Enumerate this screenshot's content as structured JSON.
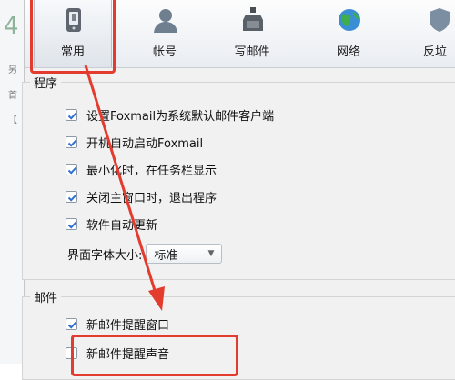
{
  "background": {
    "digit": "4",
    "side_chars": [
      "另",
      "首",
      "【"
    ]
  },
  "toolbar": {
    "tabs": [
      {
        "label": "常用",
        "icon": "phone-icon",
        "active": true
      },
      {
        "label": "帐号",
        "icon": "user-icon"
      },
      {
        "label": "写邮件",
        "icon": "ink-bottle-icon"
      },
      {
        "label": "网络",
        "icon": "globe-icon"
      },
      {
        "label": "反垃",
        "icon": "shield-icon"
      }
    ]
  },
  "program_group": {
    "title": "程序",
    "options": [
      {
        "label": "设置Foxmail为系统默认邮件客户端",
        "checked": true
      },
      {
        "label": "开机自动启动Foxmail",
        "checked": true
      },
      {
        "label": "最小化时，在任务栏显示",
        "checked": true
      },
      {
        "label": "关闭主窗口时，退出程序",
        "checked": true
      },
      {
        "label": "软件自动更新",
        "checked": true
      }
    ],
    "font_size_label": "界面字体大小:",
    "font_size_value": "标准"
  },
  "mail_group": {
    "title": "邮件",
    "options": [
      {
        "label": "新邮件提醒窗口",
        "checked": true
      },
      {
        "label": "新邮件提醒声音",
        "checked": false
      }
    ]
  },
  "colors": {
    "highlight": "#e33b2d",
    "check": "#2f6fd6"
  }
}
